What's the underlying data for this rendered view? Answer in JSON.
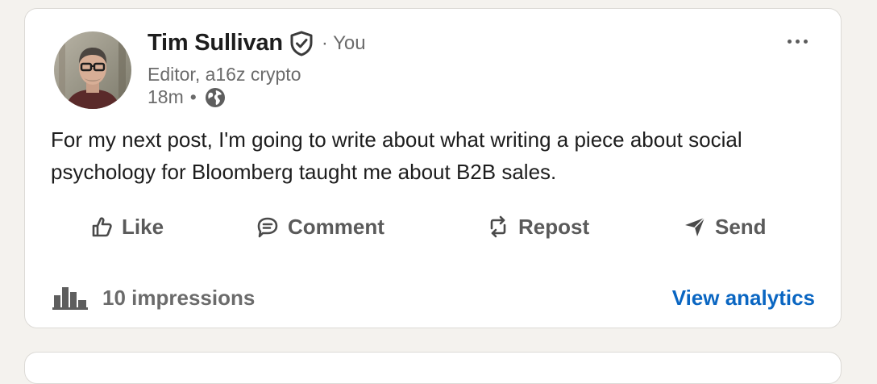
{
  "post": {
    "author": {
      "name": "Tim Sullivan",
      "relation": "You",
      "headline": "Editor, a16z crypto",
      "time": "18m",
      "verified": true,
      "visibility_icon": "globe-icon"
    },
    "body": "For my next post, I'm going to write about what writing a piece about social psychology for Bloomberg taught me about B2B sales.",
    "actions": [
      {
        "label": "Like",
        "icon": "thumbs-up-icon"
      },
      {
        "label": "Comment",
        "icon": "comment-icon"
      },
      {
        "label": "Repost",
        "icon": "repost-icon"
      },
      {
        "label": "Send",
        "icon": "send-icon"
      }
    ],
    "stats": {
      "impressions": "10 impressions",
      "analytics_link": "View analytics"
    }
  },
  "colors": {
    "link": "#0a66c2",
    "text": "#1d1d1d",
    "muted": "#6b6b6b",
    "background": "#f4f2ee"
  }
}
